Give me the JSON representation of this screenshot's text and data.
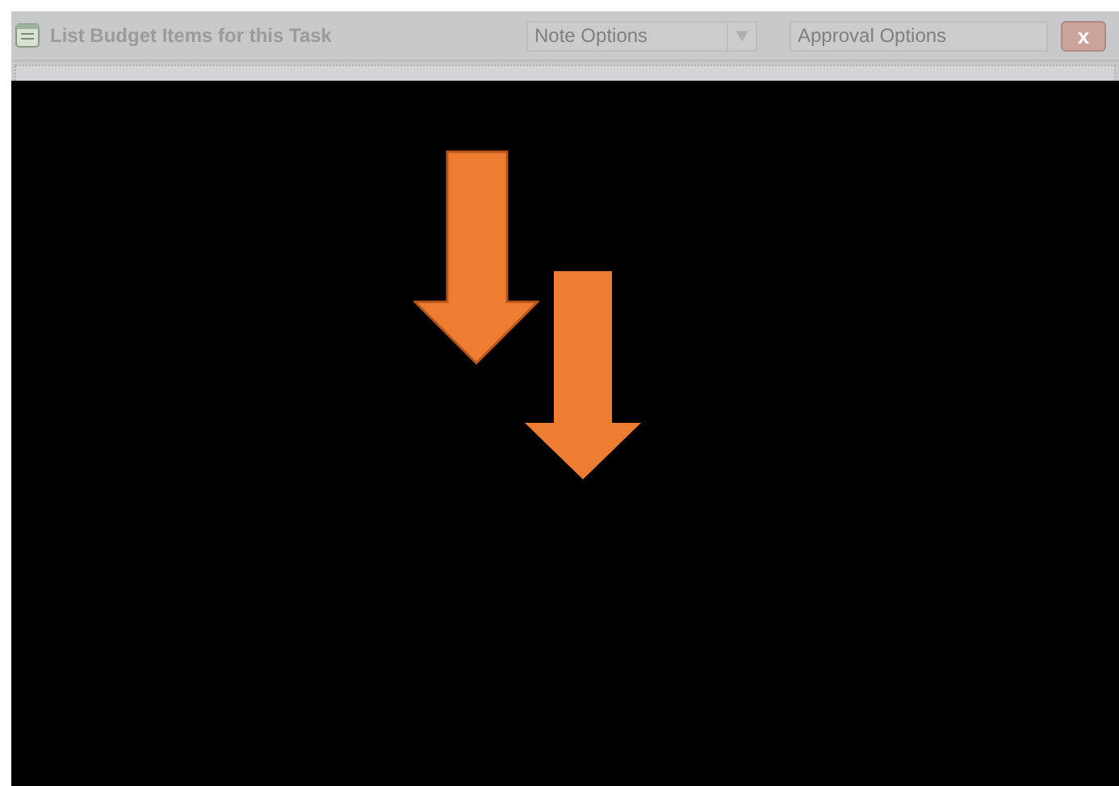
{
  "window": {
    "title": "List Budget Items for this Task"
  },
  "toolbar": {
    "dropdowns": [
      {
        "placeholder": "Note Options",
        "has_arrow": true
      },
      {
        "placeholder": "Approval Options",
        "has_arrow": false
      }
    ],
    "close_button": "x"
  }
}
